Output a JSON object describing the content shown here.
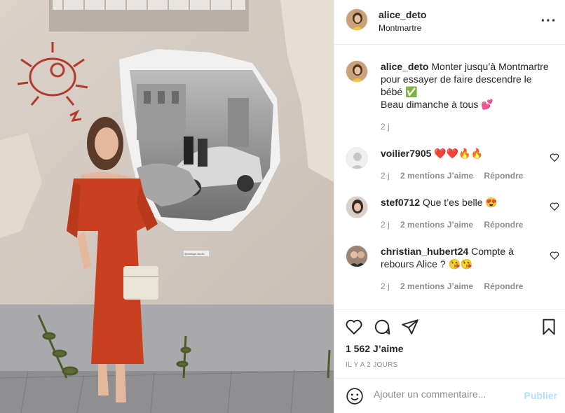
{
  "post": {
    "username": "alice_deto",
    "location": "Montmartre",
    "caption_user": "alice_deto",
    "caption_lines": [
      "Monter jusqu’à Montmartre",
      "pour essayer de faire descendre le",
      "bébé ✅",
      "Beau dimanche à tous 💕"
    ],
    "caption_time": "2 j"
  },
  "comments": [
    {
      "user": "voilier7905",
      "text": "❤️❤️🔥🔥",
      "time": "2 j",
      "mentions": "2 mentions J’aime",
      "reply": "Répondre",
      "avatar_color": "#dbdbdb"
    },
    {
      "user": "stef0712",
      "text": "Que t’es belle 😍",
      "time": "2 j",
      "mentions": "2 mentions J’aime",
      "reply": "Répondre",
      "avatar_color": "#5a4a42"
    },
    {
      "user": "christian_hubert24",
      "text": "Compte à rebours Alice ? 😘😘",
      "time": "2 j",
      "mentions": "2 mentions J’aime",
      "reply": "Répondre",
      "avatar_color": "#6b5346"
    }
  ],
  "actions": {
    "likes": "1 562 J’aime",
    "ago": "IL Y A 2 JOURS"
  },
  "add_comment": {
    "placeholder": "Ajouter un commentaire...",
    "post_label": "Publier"
  },
  "photo": {
    "sign_text": "@sintage.studio"
  },
  "colors": {
    "dress": "#c8401f",
    "wall": "#d9cfc6",
    "publish_disabled": "#b2dffc"
  }
}
